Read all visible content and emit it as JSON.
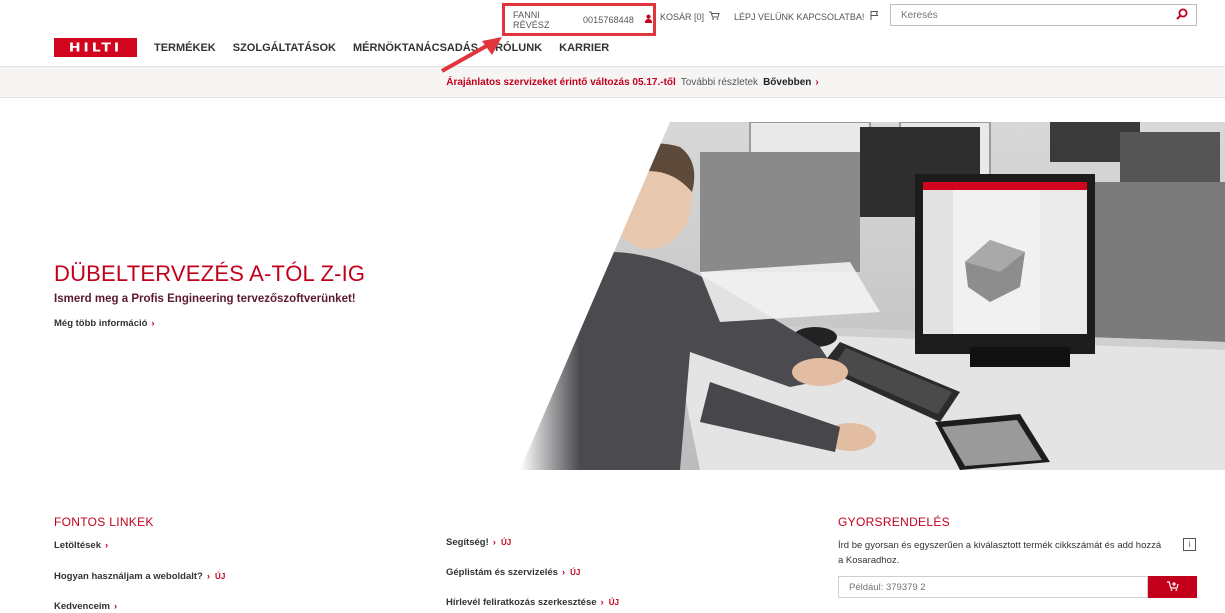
{
  "header": {
    "user_name": "FANNI RÉVÉSZ",
    "user_id": "0015768448",
    "cart_label": "KOSÁR [0]",
    "contact_label": "LÉPJ VELÜNK KAPCSOLATBA!",
    "search_placeholder": "Keresés"
  },
  "logo_text": "HILTI",
  "nav": {
    "items": [
      "TERMÉKEK",
      "SZOLGÁLTATÁSOK",
      "MÉRNÖKTANÁCSADÁS",
      "RÓLUNK",
      "KARRIER"
    ]
  },
  "notice": {
    "highlight": "Árajánlatos szervizeket érintő változás 05.17.-től",
    "details": "További részletek",
    "more": "Bővebben"
  },
  "hero": {
    "title": "DÜBELTERVEZÉS A-TÓL Z-IG",
    "subtitle": "Ismerd meg a Profis Engineering tervezőszoftverünket!",
    "link": "Még több információ"
  },
  "important_links": {
    "heading": "FONTOS LINKEK",
    "left": [
      {
        "label": "Letöltések",
        "badge": ""
      },
      {
        "label": "Hogyan használjam a weboldalt?",
        "badge": "ÚJ"
      },
      {
        "label": "Kedvenceim",
        "badge": ""
      }
    ],
    "middle": [
      {
        "label": "Segítség!",
        "badge": "ÚJ"
      },
      {
        "label": "Géplistám és szervizelés",
        "badge": "ÚJ"
      },
      {
        "label": "Hírlevél feliratkozás szerkesztése",
        "badge": "ÚJ"
      }
    ]
  },
  "quick_order": {
    "heading": "GYORSRENDELÉS",
    "description": "Írd be gyorsan és egyszerűen a kiválasztott termék cikkszámát és add hozzá a Kosaradhoz.",
    "placeholder": "Például: 379379 2",
    "info": "i"
  },
  "colors": {
    "brand_red": "#d2051e",
    "accent_red": "#c2001b",
    "annotation_red": "#e0353d"
  }
}
